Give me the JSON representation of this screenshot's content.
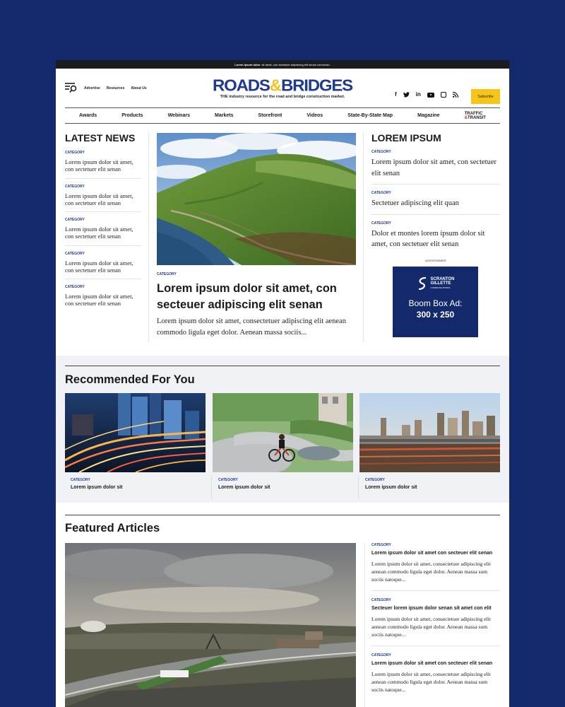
{
  "topbar": {
    "bold": "Lorem ipsum dolor",
    "rest": "sit amet, con sectetuer adipiscing elit senan commodo."
  },
  "header": {
    "util_links": [
      "Advertise",
      "Resources",
      "About Us"
    ],
    "logo": {
      "part1": "ROADS",
      "amp": "&",
      "part2": "BRIDGES"
    },
    "tagline": "THE industry resource for the road and bridge construction market.",
    "social_icons": [
      "facebook-icon",
      "twitter-icon",
      "linkedin-icon",
      "youtube-icon",
      "instagram-icon",
      "rss-icon"
    ],
    "social_glyphs": {
      "facebook": "f",
      "twitter": "🐦",
      "linkedin": "in",
      "rss": "⟟"
    },
    "subscribe_label": "Subscribe"
  },
  "nav": {
    "items": [
      "Awards",
      "Products",
      "Webinars",
      "Markets",
      "Storefront",
      "Videos",
      "State-By-State Map",
      "Magazine"
    ],
    "tt_logo": {
      "line1": "TRAFFIC",
      "amp": "&",
      "line2": "TRANSIT"
    }
  },
  "latest_news": {
    "title": "LATEST NEWS",
    "items": [
      {
        "category": "CATEGORY",
        "title": "Lorem ipsum dolor sit amet, con sectetuer elit senan"
      },
      {
        "category": "CATEGORY",
        "title": "Lorem ipsum dolor sit amet, con sectetuer elit senan"
      },
      {
        "category": "CATEGORY",
        "title": "Lorem ipsum dolor sit amet, con sectetuer elit senan"
      },
      {
        "category": "CATEGORY",
        "title": "Lorem ipsum dolor sit amet, con sectetuer elit senan"
      },
      {
        "category": "CATEGORY",
        "title": "Lorem ipsum dolor sit amet, con sectetuer elit senan"
      }
    ]
  },
  "feature": {
    "category": "CATEGORY",
    "title": "Lorem ipsum dolor sit amet, con secteuer adipiscing elit senan",
    "excerpt": "Lorem ipsum dolor sit amet, consectetuer adipiscing elit aenean commodo ligula eget dolor. Aenean massa sociis..."
  },
  "lorem_ipsum": {
    "title": "LOREM IPSUM",
    "items": [
      {
        "category": "CATEGORY",
        "title": "Lorem ipsum dolor sit amet, con sectetuer elit senan"
      },
      {
        "category": "CATEGORY",
        "title": "Sectetuer adipiscing elit quan"
      },
      {
        "category": "CATEGORY",
        "title": "Dolor et montes lorem ipsum dolor sit amet, con sectetuer elit senan"
      }
    ]
  },
  "ad": {
    "label": "ADVERTISEMENT",
    "brand_line1": "SCRANTON",
    "brand_line2": "GILLETTE",
    "brand_line3": "COMMUNICATIONS",
    "text": "Boom Box Ad:",
    "size": "300 x 250"
  },
  "recommended": {
    "title": "Recommended For You",
    "cards": [
      {
        "category": "CATEGORY",
        "title": "Lorem ipsum dolor sit"
      },
      {
        "category": "CATEGORY",
        "title": "Lorem ipsum dolor sit"
      },
      {
        "category": "CATEGORY",
        "title": "Lorem ipsum dolor sit"
      }
    ]
  },
  "featured": {
    "title": "Featured Articles",
    "items": [
      {
        "category": "CATEGORY",
        "title": "Lorem ipsum dolor sit amet con secteuer elit senan",
        "excerpt": "Lorem ipsum dolor sit amet, consectetuer adipiscing elit aenean commodo ligula eget dolor. Aenean massa sum sociis natoque..."
      },
      {
        "category": "CATEGORY",
        "title": "Secteuer lorem ipsum dolor senan sit amet con elit",
        "excerpt": "Lorem ipsum dolor sit amet, consectetuer adipiscing elit aenean commodo ligula eget dolor. Aenean massa sum sociis natoque..."
      },
      {
        "category": "CATEGORY",
        "title": "Lorem ipsum dolor sit amet con secteuer elit senan",
        "excerpt": "Lorem ipsum dolor sit amet, consectetuer adipiscing elit aenean commodo ligula eget dolor. Aenean massa sum sociis natoque..."
      }
    ]
  },
  "colors": {
    "brand_blue": "#1f3a93",
    "accent_yellow": "#f7c41a",
    "background": "#13296b"
  }
}
